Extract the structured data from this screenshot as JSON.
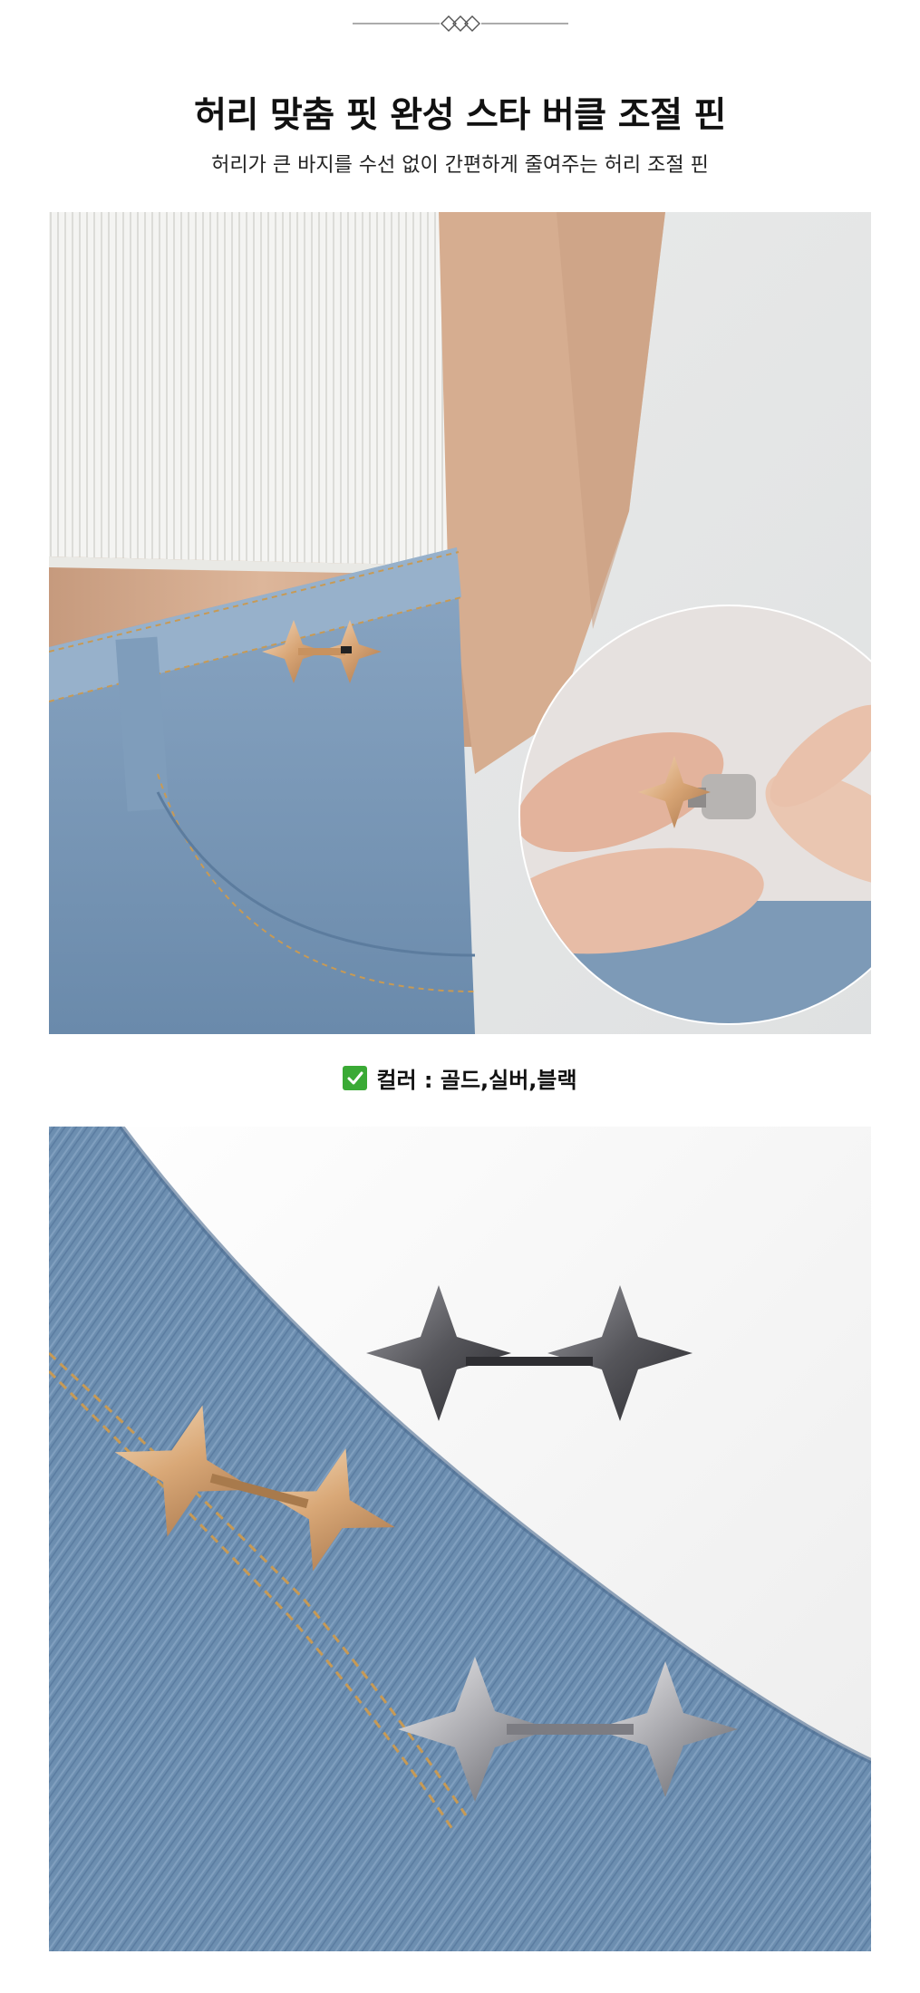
{
  "header": {
    "title": "허리 맞춤 핏 완성 스타 버클 조절 핀",
    "subtitle": "허리가 큰 바지를 수선 없이 간편하게 줄여주는 허리 조절 핀"
  },
  "color_option": {
    "text": "컬러 : 골드,실버,블랙"
  },
  "icons": {
    "divider": "diamond-divider-icon",
    "check": "check-mark-icon"
  },
  "colors": {
    "check_green": "#3aaa35",
    "gold": "#d9a877",
    "silver": "#b8b8bc",
    "black": "#4a4a4f",
    "denim": "#6c8eb0"
  }
}
